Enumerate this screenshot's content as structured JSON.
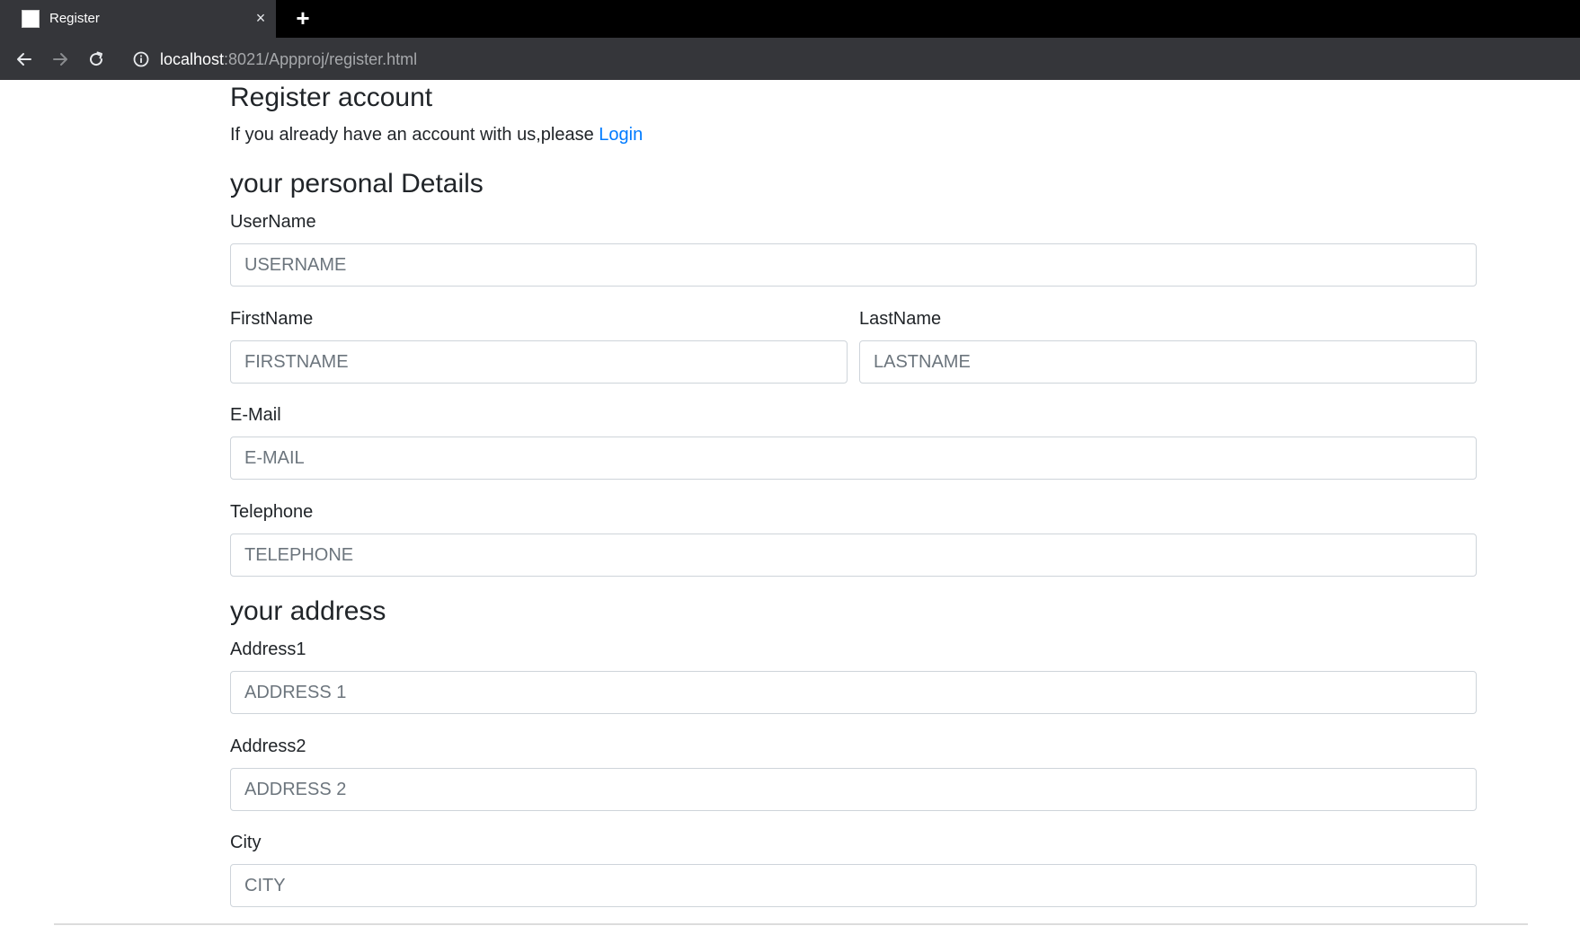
{
  "browser": {
    "tab_title": "Register",
    "close_glyph": "×",
    "new_tab_glyph": "+",
    "url_host": "localhost",
    "url_rest": ":8021/Appproj/register.html"
  },
  "page": {
    "title": "Register account",
    "intro_text": "If you already have an account with us,please ",
    "login_link": "Login",
    "section_personal": "your personal Details",
    "section_address": "your address"
  },
  "fields": {
    "username": {
      "label": "UserName",
      "placeholder": "USERNAME"
    },
    "firstname": {
      "label": "FirstName",
      "placeholder": "FIRSTNAME"
    },
    "lastname": {
      "label": "LastName",
      "placeholder": "LASTNAME"
    },
    "email": {
      "label": "E-Mail",
      "placeholder": "E-MAIL"
    },
    "telephone": {
      "label": "Telephone",
      "placeholder": "TELEPHONE"
    },
    "address1": {
      "label": "Address1",
      "placeholder": "ADDRESS 1"
    },
    "address2": {
      "label": "Address2",
      "placeholder": "ADDRESS 2"
    },
    "city": {
      "label": "City",
      "placeholder": "CITY"
    }
  },
  "colors": {
    "link": "#007bff",
    "chrome_dark": "#35363a",
    "tabstrip": "#000000"
  },
  "icons": {
    "back": "arrow-left-icon",
    "forward": "arrow-right-icon",
    "reload": "reload-icon",
    "info": "info-icon",
    "favicon": "page-favicon-icon"
  }
}
